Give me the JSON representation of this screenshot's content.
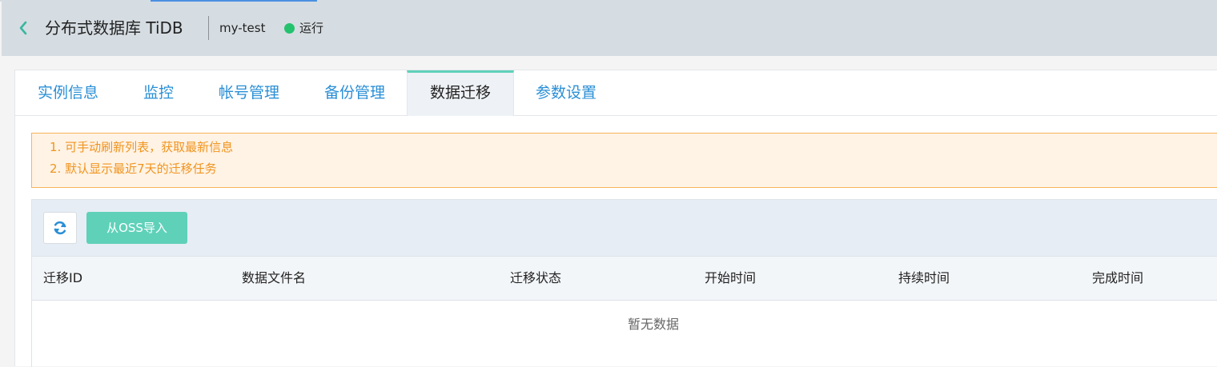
{
  "header": {
    "title": "分布式数据库 TiDB",
    "instance_name": "my-test",
    "status_text": "运行",
    "status_color": "#25c26e",
    "back_icon": "chevron-left-icon"
  },
  "tabs": [
    {
      "label": "实例信息",
      "active": false
    },
    {
      "label": "监控",
      "active": false
    },
    {
      "label": "帐号管理",
      "active": false
    },
    {
      "label": "备份管理",
      "active": false
    },
    {
      "label": "数据迁移",
      "active": true
    },
    {
      "label": "参数设置",
      "active": false
    }
  ],
  "notice": {
    "lines": [
      "1. 可手动刷新列表，获取最新信息",
      "2. 默认显示最近7天的迁移任务"
    ]
  },
  "toolbar": {
    "refresh_icon": "refresh-icon",
    "import_label": "从OSS导入"
  },
  "table": {
    "columns": [
      "迁移ID",
      "数据文件名",
      "迁移状态",
      "开始时间",
      "持续时间",
      "完成时间"
    ],
    "rows": [],
    "empty_text": "暂无数据"
  },
  "colors": {
    "accent": "#5fd1b9",
    "link": "#2a8fd6",
    "notice_text": "#f0941f",
    "notice_border": "#f6b35a"
  }
}
